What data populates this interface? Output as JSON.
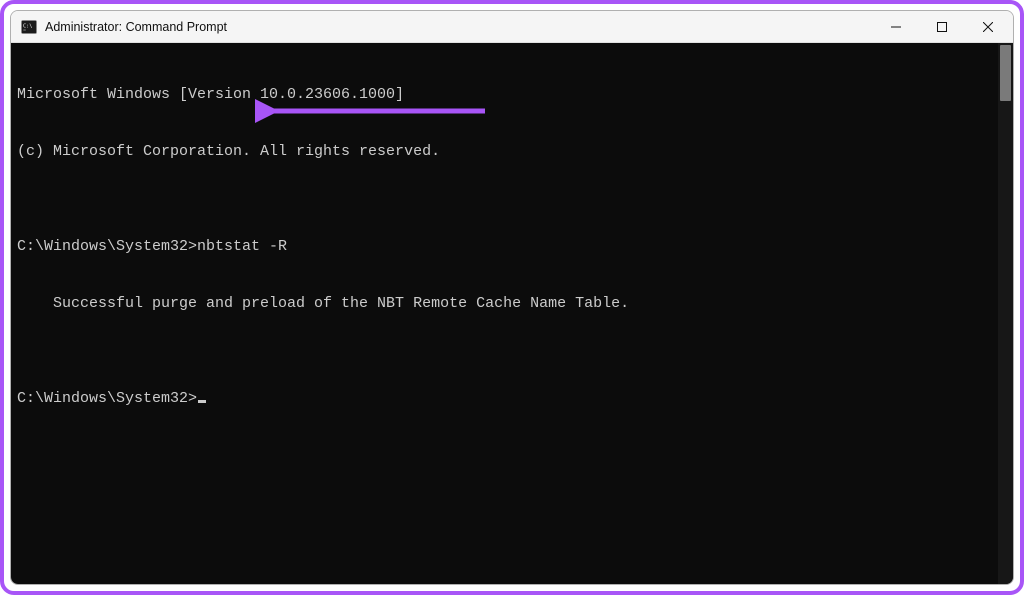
{
  "window": {
    "title": "Administrator: Command Prompt"
  },
  "terminal": {
    "lines": [
      "Microsoft Windows [Version 10.0.23606.1000]",
      "(c) Microsoft Corporation. All rights reserved.",
      "",
      "    Successful purge and preload of the NBT Remote Cache Name Table.",
      ""
    ],
    "prompt1_path": "C:\\Windows\\System32>",
    "prompt1_cmd": "nbtstat -R",
    "prompt2_path": "C:\\Windows\\System32>",
    "prompt2_cmd": ""
  },
  "annotation": {
    "color": "#a855f7"
  }
}
